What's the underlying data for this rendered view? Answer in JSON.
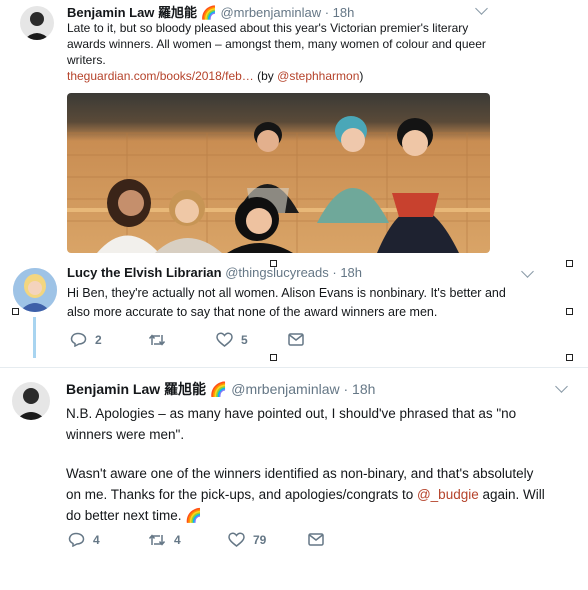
{
  "tweet1": {
    "name": "Benjamin Law 羅旭能",
    "emoji": "🌈",
    "handle": "@mrbenjaminlaw",
    "time": "· 18h",
    "line1": "Late to it, but so bloody pleased about this year's Victorian premier's literary",
    "line2": "awards winners. All women – amongst them, many women of colour and queer",
    "line3": "writers.",
    "link": "theguardian.com/books/2018/feb…",
    "by_prefix": " (by ",
    "by_handle": "@stephharmon",
    "by_suffix": ")"
  },
  "tweet2": {
    "name": "Lucy the Elvish Librarian",
    "handle": "@thingslucyreads",
    "time": "· 18h",
    "line1": "Hi Ben, they're actually not all women. Alison Evans is nonbinary. It's better and",
    "line2": "also more accurate to say that none of the award winners are men.",
    "replies": "2",
    "retweets": "",
    "likes": "5"
  },
  "tweet3": {
    "name": "Benjamin Law 羅旭能",
    "emoji": "🌈",
    "handle": "@mrbenjaminlaw",
    "time": "· 18h",
    "p1_line1": "N.B. Apologies – as many have pointed out, I should've phrased that as \"no",
    "p1_line2": "winners were men\".",
    "p2_line1": "Wasn't aware one of the winners identified as non-binary, and that's absolutely",
    "p2_line2_a": "on me. Thanks for the pick-ups, and apologies/congrats to ",
    "p2_mention": "@_budgie",
    "p2_line2_b": " again. Will",
    "p2_line3": "do better next time. ",
    "p2_emoji": "🌈",
    "replies": "4",
    "retweets": "4",
    "likes": "79"
  },
  "colors": {
    "link": "#b5432b",
    "meta": "#657786",
    "thread_line": "#a8d4f0"
  }
}
